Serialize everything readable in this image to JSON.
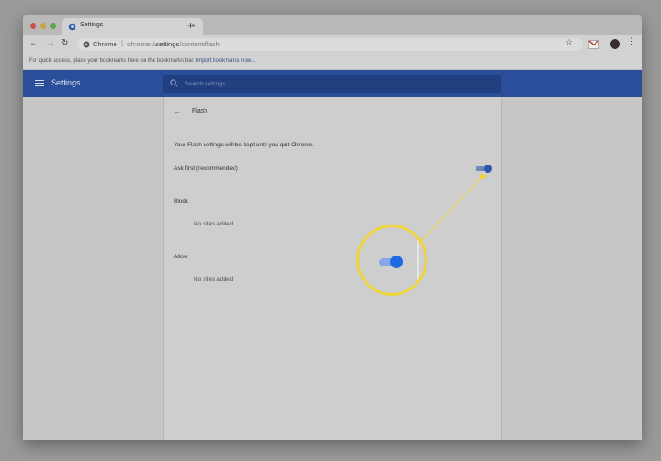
{
  "browser": {
    "tab_title": "Settings",
    "tab_close": "×",
    "new_tab": "+",
    "omnibox_origin": "Chrome",
    "omnibox_separator": "|",
    "omnibox_url_prefix": "chrome://",
    "omnibox_url_host": "settings",
    "omnibox_url_path": "/content/flash",
    "bookmarks_prompt": "For quick access, place your bookmarks here on the bookmarks bar.",
    "bookmarks_import": "Import bookmarks now..."
  },
  "header": {
    "title": "Settings",
    "search_placeholder": "Search settings"
  },
  "page": {
    "title": "Flash",
    "description": "Your Flash settings will be kept until you quit Chrome.",
    "ask_first_label": "Ask first (recommended)",
    "ask_first_enabled": true,
    "block_label": "Block",
    "block_empty": "No sites added",
    "allow_label": "Allow",
    "allow_empty": "No sites added"
  },
  "colors": {
    "header_blue": "#2a4e9a",
    "toggle_on": "#1f6ae3",
    "callout_yellow": "#f0d43a"
  },
  "icons": [
    "close-icon",
    "settings-gear-icon",
    "back-icon",
    "forward-icon",
    "reload-icon",
    "secure-icon",
    "star-icon",
    "gmail-icon",
    "avatar",
    "more-vert-icon",
    "hamburger-menu-icon",
    "search-icon",
    "back-arrow-icon"
  ]
}
